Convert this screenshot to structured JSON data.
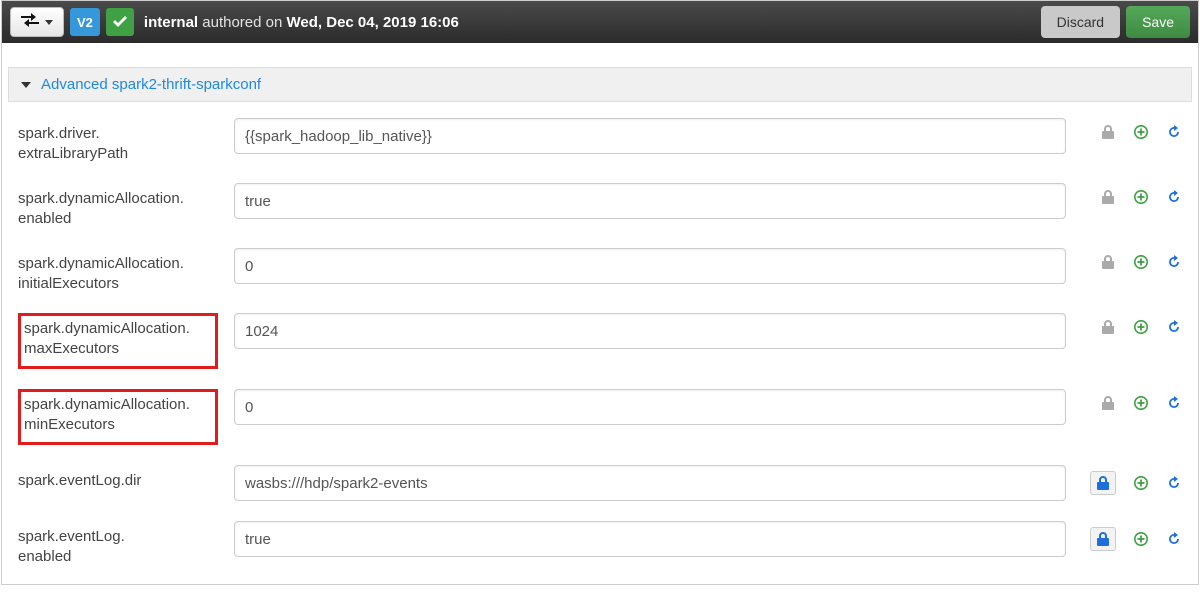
{
  "topbar": {
    "version_badge": "V2",
    "user": "internal",
    "authored_label": "authored on",
    "authored_date": "Wed, Dec 04, 2019 16:06",
    "discard_label": "Discard",
    "save_label": "Save"
  },
  "section": {
    "title": "Advanced spark2-thrift-sparkconf"
  },
  "rows": [
    {
      "label": "spark.driver.extraLibraryPath",
      "value": "{{spark_hadoop_lib_native}}",
      "highlight": false,
      "locked_active": false
    },
    {
      "label": "spark.dynamicAllocation.enabled",
      "value": "true",
      "highlight": false,
      "locked_active": false
    },
    {
      "label": "spark.dynamicAllocation.initialExecutors",
      "value": "0",
      "highlight": false,
      "locked_active": false
    },
    {
      "label": "spark.dynamicAllocation.maxExecutors",
      "value": "1024",
      "highlight": true,
      "locked_active": false
    },
    {
      "label": "spark.dynamicAllocation.minExecutors",
      "value": "0",
      "highlight": true,
      "locked_active": false
    },
    {
      "label": "spark.eventLog.dir",
      "value": "wasbs:///hdp/spark2-events",
      "highlight": false,
      "locked_active": true
    },
    {
      "label": "spark.eventLog.enabled",
      "value": "true",
      "highlight": false,
      "locked_active": true
    }
  ]
}
